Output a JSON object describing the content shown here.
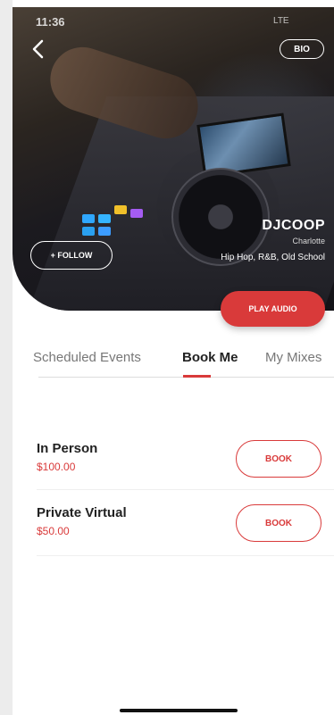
{
  "status_bar": {
    "time": "11:36",
    "network": "LTE"
  },
  "header": {
    "bio_label": "BIO",
    "follow_label": "+ FOLLOW",
    "play_audio_label": "PLAY AUDIO"
  },
  "profile": {
    "name": "DJCOOP",
    "city": "Charlotte",
    "genres": "Hip Hop, R&B, Old School"
  },
  "tabs": [
    {
      "label": "Scheduled Events",
      "active": false
    },
    {
      "label": "Book Me",
      "active": true
    },
    {
      "label": "My Mixes",
      "active": false
    }
  ],
  "booking_options": [
    {
      "title": "In Person",
      "price": "$100.00",
      "button_label": "BOOK"
    },
    {
      "title": "Private Virtual",
      "price": "$50.00",
      "button_label": "BOOK"
    }
  ],
  "colors": {
    "accent": "#d93a3a",
    "text_primary": "#222222",
    "text_secondary": "#777777"
  },
  "icons": {
    "back": "chevron-left-icon"
  }
}
